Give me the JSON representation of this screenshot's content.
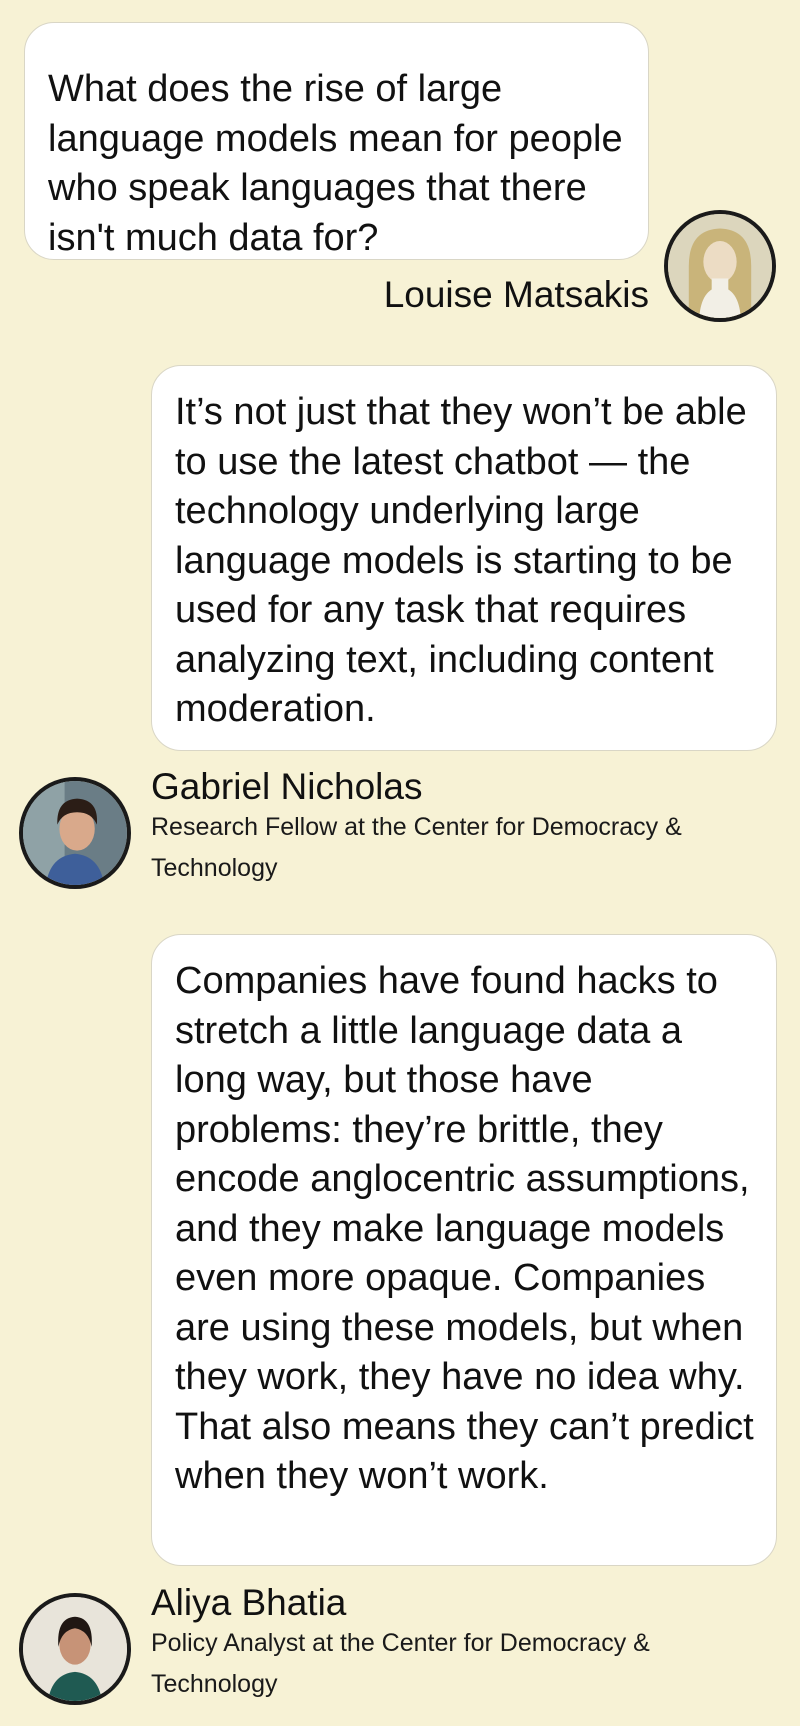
{
  "conversation": {
    "messages": [
      {
        "text": "What does the rise of large language models mean for people who speak languages that there isn't much data for?",
        "speaker": "Louise Matsakis",
        "avatar_icon": "person-portrait-icon"
      },
      {
        "text": "It’s not just that they won’t be able to use the latest chatbot — the technology underlying large language models is starting to be used for any task that requires analyzing text, including content moderation.",
        "speaker": "Gabriel Nicholas",
        "role": "Research Fellow at the Center for Democracy & Technology",
        "avatar_icon": "person-portrait-icon"
      },
      {
        "text": "Companies have found hacks to stretch a little language data a long way, but those have problems: they’re brittle, they encode anglocentric assumptions, and they make language models even more opaque. Companies are using these models, but when they work, they have no idea why. That also means they can’t predict when they won’t work.",
        "speaker": "Aliya Bhatia",
        "role": "Policy Analyst at the Center for Democracy & Technology",
        "avatar_icon": "person-portrait-icon"
      }
    ]
  },
  "colors": {
    "background": "#f7f2d5",
    "bubble": "#ffffff",
    "bubble_border": "#d9d6c6",
    "text": "#111111",
    "avatar_ring": "#1a1a1a"
  }
}
